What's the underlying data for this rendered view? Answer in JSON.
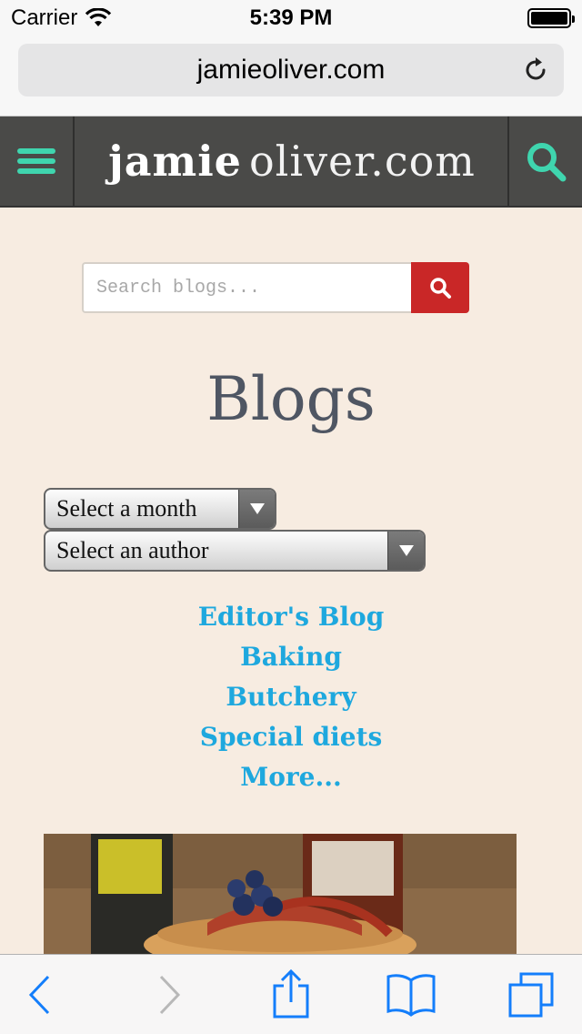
{
  "status_bar": {
    "carrier": "Carrier",
    "time": "5:39 PM"
  },
  "address_bar": {
    "url": "jamieoliver.com"
  },
  "site_header": {
    "logo_part1": "jamie",
    "logo_part2": "oliver.com"
  },
  "blog_search": {
    "placeholder": "Search blogs..."
  },
  "page": {
    "title": "Blogs"
  },
  "filters": {
    "month": "Select a month",
    "author": "Select an author"
  },
  "categories": [
    "Editor's Blog",
    "Baking",
    "Butchery",
    "Special diets",
    "More..."
  ],
  "colors": {
    "accent_teal": "#3fd5ae",
    "header_bg": "#4a4a48",
    "search_red": "#c92727",
    "link_blue": "#1ea8de",
    "page_bg": "#f7ece1",
    "title_gray": "#4f5663",
    "ios_blue": "#147efb"
  }
}
